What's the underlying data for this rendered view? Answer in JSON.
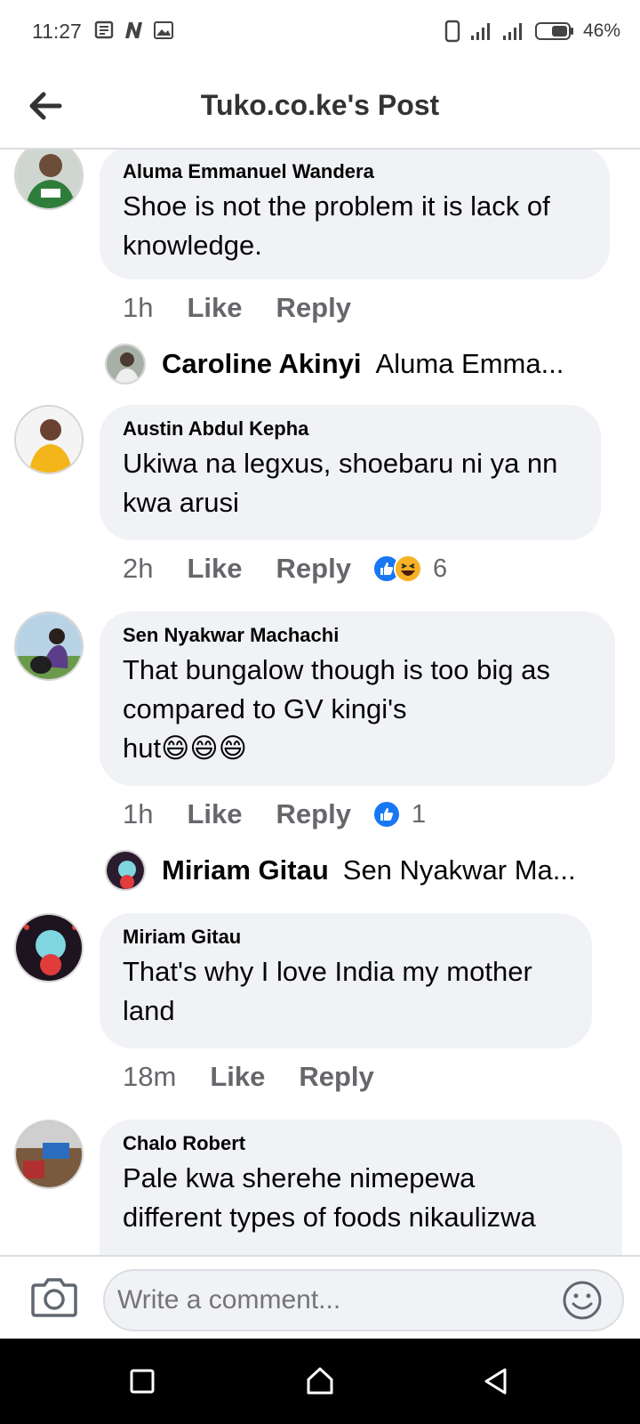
{
  "status_bar": {
    "time": "11:27",
    "battery": "46%"
  },
  "header": {
    "title": "Tuko.co.ke's Post"
  },
  "comments": [
    {
      "name": "Aluma Emmanuel Wandera",
      "lines": [
        "Shoe is not the  problem it is lack of",
        "knowledge."
      ],
      "time": "1h",
      "like": "Like",
      "reply": "Reply",
      "reply_preview": {
        "name": "Caroline Akinyi",
        "text": "Aluma Emma..."
      }
    },
    {
      "name": "Austin Abdul Kepha",
      "lines": [
        "Ukiwa na legxus, shoebaru ni ya nn",
        "kwa arusi"
      ],
      "time": "2h",
      "like": "Like",
      "reply": "Reply",
      "reactions": [
        "like",
        "haha"
      ],
      "reaction_count": "6"
    },
    {
      "name": "Sen Nyakwar Machachi",
      "lines": [
        "That bungalow though is too big as",
        "compared to GV kingi's",
        "hut😄😄😄"
      ],
      "time": "1h",
      "like": "Like",
      "reply": "Reply",
      "reactions": [
        "like"
      ],
      "reaction_count": "1",
      "reply_preview": {
        "name": "Miriam Gitau",
        "text": "Sen Nyakwar Ma..."
      }
    },
    {
      "name": "Miriam Gitau",
      "lines": [
        "That's why I love India my mother",
        "land"
      ],
      "time": "18m",
      "like": "Like",
      "reply": "Reply"
    },
    {
      "name": "Chalo Robert",
      "lines": [
        "Pale kwa sherehe nimepewa",
        "different types of foods nikaulizwa"
      ]
    }
  ],
  "composer": {
    "placeholder": "Write a comment..."
  },
  "icons": {
    "back": "arrow-left-icon",
    "camera": "camera-icon",
    "emoji": "smiley-icon",
    "nav": [
      "square-recents-icon",
      "home-icon",
      "triangle-back-icon"
    ]
  },
  "colors": {
    "bubble": "#f0f2f5",
    "meta_text": "#65676b",
    "like_blue": "#1877f2",
    "haha_yellow": "#f7b125"
  }
}
